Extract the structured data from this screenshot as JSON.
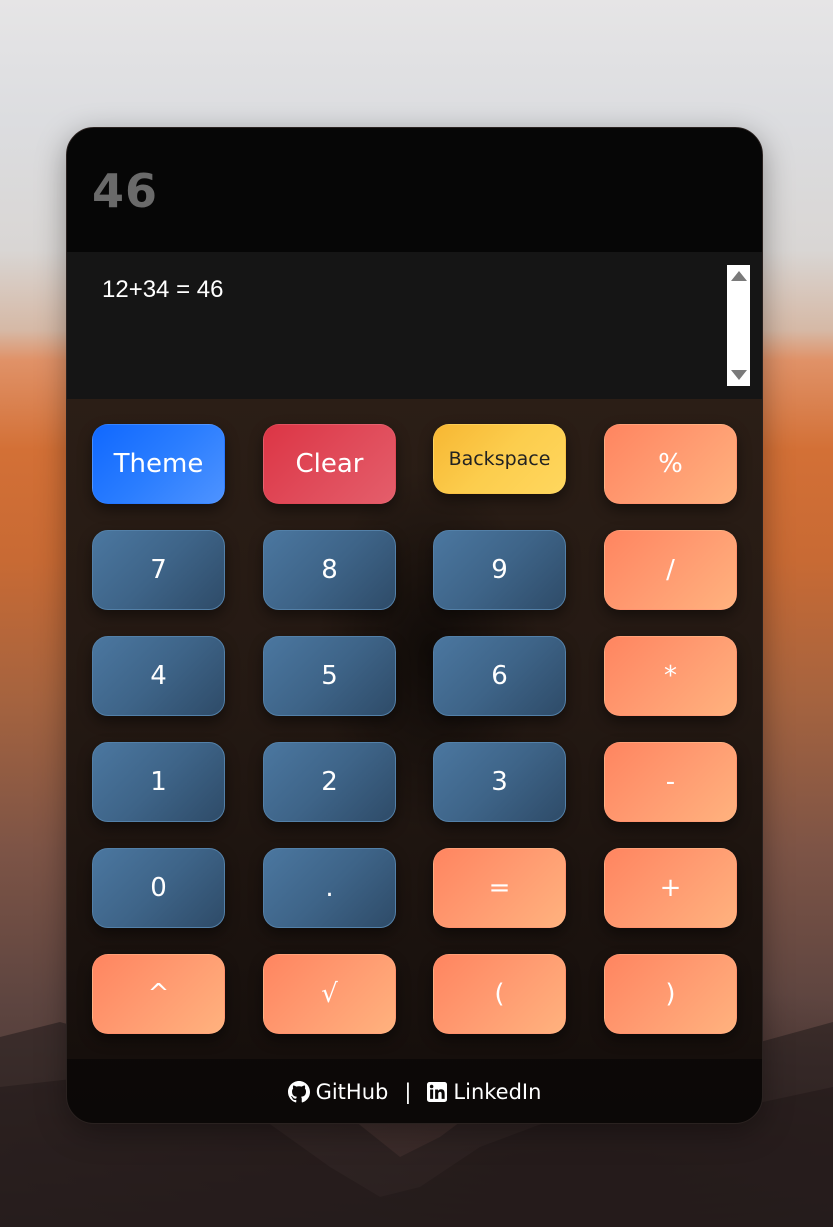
{
  "display": {
    "value": "46"
  },
  "history": {
    "entries": [
      "12+34 = 46"
    ]
  },
  "keys": {
    "row1": [
      "Theme",
      "Clear",
      "Backspace",
      "%"
    ],
    "row2": [
      "7",
      "8",
      "9",
      "/"
    ],
    "row3": [
      "4",
      "5",
      "6",
      "*"
    ],
    "row4": [
      "1",
      "2",
      "3",
      "-"
    ],
    "row5": [
      "0",
      ".",
      "=",
      "+"
    ],
    "row6": [
      "^",
      "√",
      "(",
      ")"
    ]
  },
  "footer": {
    "github": "GitHub",
    "separator": "|",
    "linkedin": "LinkedIn"
  },
  "icons": {
    "github": "github-icon",
    "linkedin": "linkedin-icon"
  },
  "colors": {
    "number_key": "#3e6488",
    "operator_key": "#ff9b71",
    "theme_key": "#2a7dff",
    "clear_key": "#e04a59",
    "backspace_key": "#fccd4d"
  }
}
